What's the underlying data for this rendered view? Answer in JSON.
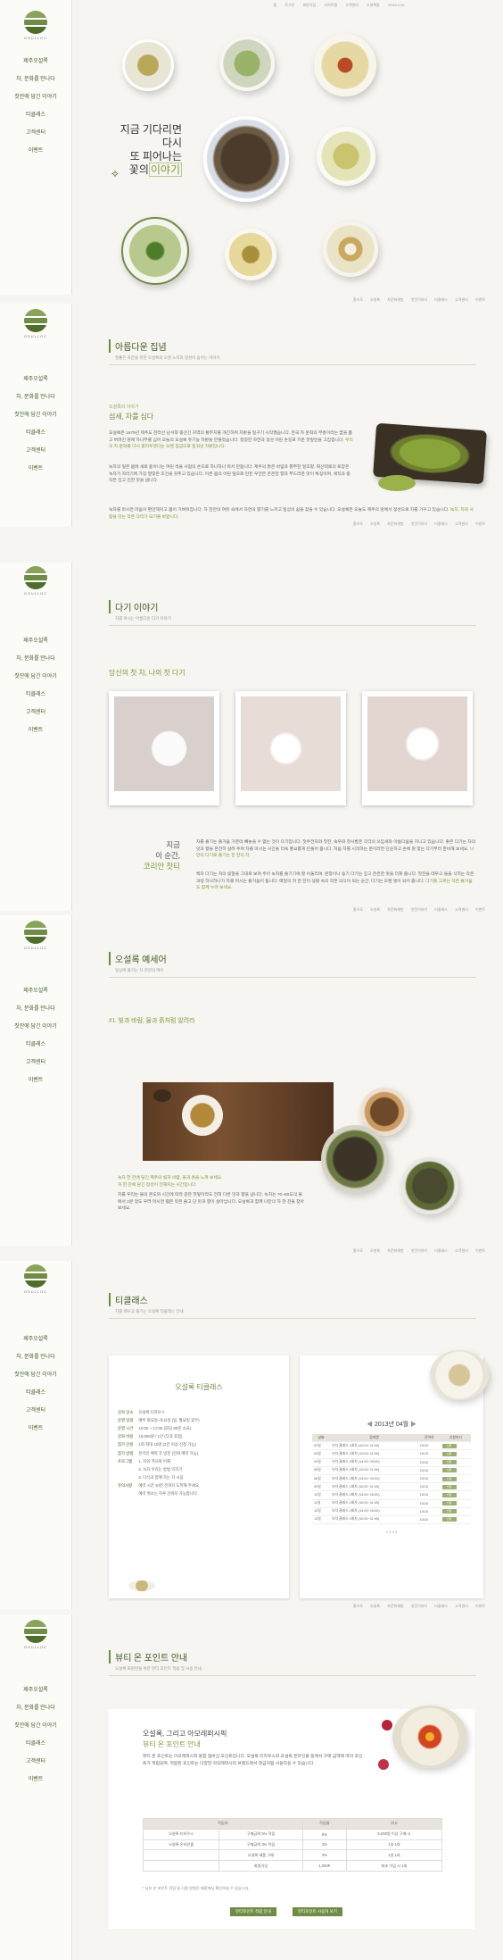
{
  "brand": "OSULLOC",
  "nav": [
    "제주오설록",
    "차, 문화를 만나다",
    "찻잔에 담긴 이야기",
    "티클래스",
    "고객센터",
    "이벤트"
  ],
  "top_links": [
    "홈",
    "로그인",
    "회원가입",
    "사이트맵",
    "고객센터",
    "오설록몰",
    "OSULLOC"
  ],
  "hero": {
    "copy_lines": [
      "지금 기다리면",
      "다시",
      "또 피어나는",
      "꽃의"
    ],
    "copy_accent": "이야기"
  },
  "subnav": [
    "홈으로",
    "오설록",
    "차문화체험",
    "찻잔이야기",
    "티클래스",
    "고객센터",
    "이벤트"
  ],
  "sec1": {
    "title": "아름다운 집념",
    "subtitle": "질좋은 차만을 위한 오설록의 오랜 노력과 정성이 숨쉬는 이야기",
    "kicker": "오설록의 이야기",
    "heading": "섬세, 차를 심다",
    "p1": "오설록은 1979년 제주도 한라산 남서쪽 중산간 지역의 황무지를 개간하여 차밭을 일구기 시작했습니다. 한국 차 문화의 부흥이라는 꿈을 품고 버려진 땅에 차나무를 심어 오늘의 오설록 유기농 차밭을 만들었습니다. 청정한 자연과 정성 어린 손길로 키운 찻잎만을 고집합니다.",
    "p1_hl": "우리의 차 문화를 다시 꽃피우겠다는 오랜 집념으로 일궈낸 차밭입니다.",
    "p2": "녹차의 잎은 봄에 새로 돋아나는 여린 싹을 사람의 손으로 하나하나 따서 만듭니다. 제주의 맑은 바람과 풍부한 일조량, 화산회토의 토양은 녹차가 자라기에 가장 알맞은 조건을 갖추고 있습니다. 이른 봄의 어린 잎으로 만든 우전은 은은한 향과 부드러운 맛이 특징이며, 세작과 중작은 깊고 진한 맛을 냅니다.",
    "p3": "녹차를 마시면 마음이 편안해지고 몸이 가벼워집니다. 차 한잔의 여유 속에서 자연의 향기를 느끼고 일상의 쉼을 찾을 수 있습니다. 오설록은 오늘도 제주의 땅에서 정성으로 차를 가꾸고 있습니다.",
    "p3_hl": "녹차, 차와 사람을 잇는 작은 다리가 되기를 바랍니다."
  },
  "sec2": {
    "title": "다기 이야기",
    "subtitle": "차를 마시는 아름다운 다기 이야기",
    "heading": "당신의 첫 차, 나의 첫 다기",
    "side_lines": [
      "지금",
      "이 순간,"
    ],
    "side_accent": "코리안 찻티",
    "p1": "차를 즐기는 즐거움 가운데 빼놓을 수 없는 것이 다기입니다. 찻주전자와 찻잔, 숙우와 찻사발은 각각의 쓰임새와 아름다움을 지니고 있습니다. 좋은 다기는 차의 맛과 향을 온전히 살려 주며 차를 마시는 시간을 더욱 풍요롭게 만들어 줍니다. 처음 차를 시작하는 분이라면 단순하고 손에 잘 맞는 다기부터 준비해 보세요.",
    "p1_hl": "나만의 다기로 즐기는 한 잔의 차",
    "p2": "백자 다기는 차의 빛깔을 그대로 보여 주어 녹차를 즐기기에 잘 어울리며, 분청이나 옹기 다기는 깊고 은은한 멋을 더해 줍니다. 찻잔을 데우고 물을 식히는 작은 과정 하나하나가 차를 마시는 즐거움이 됩니다. 매일의 차 한 잔이 생활 속의 작은 의식이 되는 순간, 다기는 오랜 벗이 되어 줍니다.",
    "p2_hl": "다기를 고르는 작은 즐거움도 함께 누려 보세요."
  },
  "sec3": {
    "title": "오설록 예세어",
    "subtitle": "일상에 즐기는 차 한잔의 여유",
    "heading": "#1. 빛과 바람, 물과 흙처럼 알려라",
    "hl1": "녹차 한 잔에 담긴 제주의 빛과 바람, 물과 흙을 느껴 보세요.",
    "hl2": "차 한 잔에 담긴 정성이 전해지는 시간입니다.",
    "p": "차를 우리는 물의 온도와 시간에 따라 같은 찻잎이라도 전혀 다른 맛과 향을 냅니다. 녹차는 70~80도의 물에서 2분 정도 우려 마시면 떫은 맛은 줄고 단 맛과 향이 살아납니다. 오설록과 함께 나만의 차 한 잔을 찾아 보세요."
  },
  "sec4": {
    "title": "티클래스",
    "subtitle": "차를 배우고 즐기는 오설록 티클래스 안내",
    "card_title": "오설록 티클래스",
    "info": [
      {
        "k": "강좌 장소",
        "v": "오설록 티하우스"
      },
      {
        "k": "운영 일정",
        "v": "매주 화요일~토요일 (일, 월요일 휴무)"
      },
      {
        "k": "운영 시간",
        "v": "10:00 ~ 17:00 (회당 60분 소요)"
      },
      {
        "k": "강좌 비용",
        "v": "15,000원 / 1인 (다과 포함)"
      },
      {
        "k": "참가 인원",
        "v": "1회 최대 10명 (2인 이상 신청 가능)"
      },
      {
        "k": "참가 방법",
        "v": "온라인 예약 후 방문 (전화 예약 가능)"
      },
      {
        "k": "프로그램",
        "v": "1. 차의 역사와 이해"
      },
      {
        "k": "",
        "v": "2. 녹차 우리는 방법 익히기"
      },
      {
        "k": "",
        "v": "3. 다식과 함께 하는 차 시음"
      },
      {
        "k": "유의사항",
        "v": "예약 시간 10분 전까지 도착해 주세요."
      },
      {
        "k": "",
        "v": "예약 취소는 하루 전까지 가능합니다."
      }
    ],
    "calendar_title": "2013년 04월",
    "cal_headers": [
      "날짜",
      "강좌명",
      "잔여석",
      "신청하기"
    ],
    "cal_rows": [
      {
        "d": "02일",
        "c": "녹차 클래스 1회차 (10:00~11:00)",
        "r": "10/10"
      },
      {
        "d": "03일",
        "c": "녹차 클래스 1회차 (10:00~11:00)",
        "r": "10/10"
      },
      {
        "d": "04일",
        "c": "녹차 클래스 2회차 (14:00~15:00)",
        "r": "10/10"
      },
      {
        "d": "05일",
        "c": "녹차 클래스 1회차 (10:00~11:00)",
        "r": "10/10"
      },
      {
        "d": "06일",
        "c": "녹차 클래스 2회차 (14:00~15:00)",
        "r": "10/10"
      },
      {
        "d": "09일",
        "c": "녹차 클래스 1회차 (10:00~11:00)",
        "r": "10/10"
      },
      {
        "d": "10일",
        "c": "녹차 클래스 2회차 (14:00~15:00)",
        "r": "10/10"
      },
      {
        "d": "11일",
        "c": "녹차 클래스 1회차 (10:00~11:00)",
        "r": "10/10"
      },
      {
        "d": "12일",
        "c": "녹차 클래스 2회차 (14:00~15:00)",
        "r": "10/10"
      },
      {
        "d": "13일",
        "c": "녹차 클래스 1회차 (10:00~11:00)",
        "r": "10/10"
      }
    ],
    "apply_label": "신청",
    "pages": "1 2 3 4"
  },
  "sec5": {
    "title": "뷰티 온 포인트 안내",
    "subtitle": "오설록 회원만을 위한 뷰티 포인트 적립 및 사용 안내",
    "heading1": "오설록, 그리고 아모레퍼시픽",
    "heading2": "뷰티 온 포인트 안내",
    "p": "뷰티 온 포인트는 아모레퍼시픽 통합 멤버십 포인트입니다. 오설록 티하우스와 오설록 온라인몰 등에서 구매 금액에 따라 포인트가 적립되며, 적립된 포인트는 다양한 아모레퍼시픽 브랜드에서 현금처럼 사용하실 수 있습니다.",
    "table_headers": [
      "적립처",
      "적립율",
      "비고"
    ],
    "table_rows": [
      {
        "a": "오설록 티하우스",
        "b": "구매금액 5% 적립",
        "c": "5%",
        "d": "5,000원 이상 구매 시"
      },
      {
        "a": "오설록 온라인몰",
        "b": "구매금액 3% 적립",
        "c": "3%",
        "d": "1일 1회"
      },
      {
        "a": "",
        "b": "오설록 제품 구매",
        "c": "3%",
        "d": "1일 1회"
      },
      {
        "a": "",
        "b": "회원가입",
        "c": "1,000P",
        "d": "최초 가입 시 1회"
      }
    ],
    "note": "* 뷰티 온 포인트 적립 및 사용 방법은 매장에서 확인하실 수 있습니다.",
    "btn1": "뷰티포인트 적립 안내",
    "btn2": "뷰티포인트 사용처 보기"
  }
}
